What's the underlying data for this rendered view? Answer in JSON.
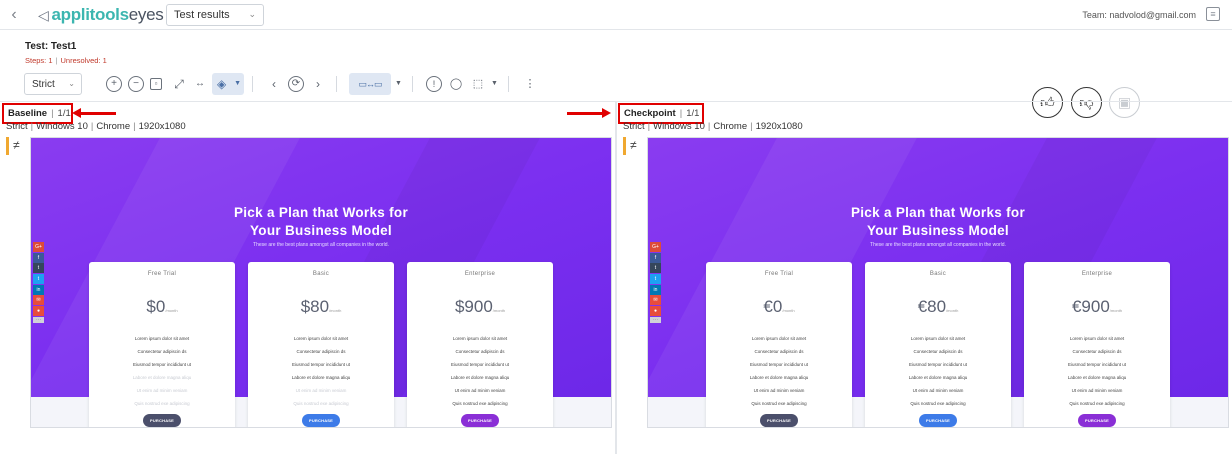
{
  "header": {
    "back_label": "‹",
    "logo_brand": "applitools",
    "logo_product": "eyes",
    "results_select": "Test results",
    "team": "Team: nadvolod@gmail.com"
  },
  "test": {
    "title": "Test: Test1",
    "steps": "Steps: 1",
    "unresolved": "Unresolved: 1"
  },
  "toolbar": {
    "match_level": "Strict"
  },
  "baseline": {
    "label": "Baseline",
    "count": "1/1",
    "level": "Strict",
    "os": "Windows 10",
    "browser": "Chrome",
    "viewport": "1920x1080"
  },
  "checkpoint": {
    "label": "Checkpoint",
    "count": "1/1",
    "level": "Strict",
    "os": "Windows 10",
    "browser": "Chrome",
    "viewport": "1920x1080"
  },
  "page": {
    "headline_1": "Pick a Plan that Works for",
    "headline_2": "Your Business Model",
    "subhead": "These are the best plans amongst all companies in the world.",
    "month": "/month",
    "purchase": "PURCHASE",
    "plans": [
      {
        "name": "Free Trial",
        "color": "#4b4f6b"
      },
      {
        "name": "Basic",
        "color": "#3d7be8"
      },
      {
        "name": "Enterprise",
        "color": "#8a2fd6"
      }
    ],
    "baseline_prices": [
      "$0",
      "$80",
      "$900"
    ],
    "checkpoint_prices": [
      "€0",
      "€80",
      "€900"
    ],
    "features": [
      "Lorem ipsum dolor sit amet",
      "Consectetur adipiscin ds",
      "Eiusmod tempor incididunt ut",
      "Labore et dolore magna aliqu",
      "Ut enim ad minim veniam",
      "Quis nostrud exe adipiscing"
    ]
  },
  "colors": {
    "accent": "#3cb6b0",
    "highlight": "#e00000",
    "diff": "#f0a830"
  }
}
